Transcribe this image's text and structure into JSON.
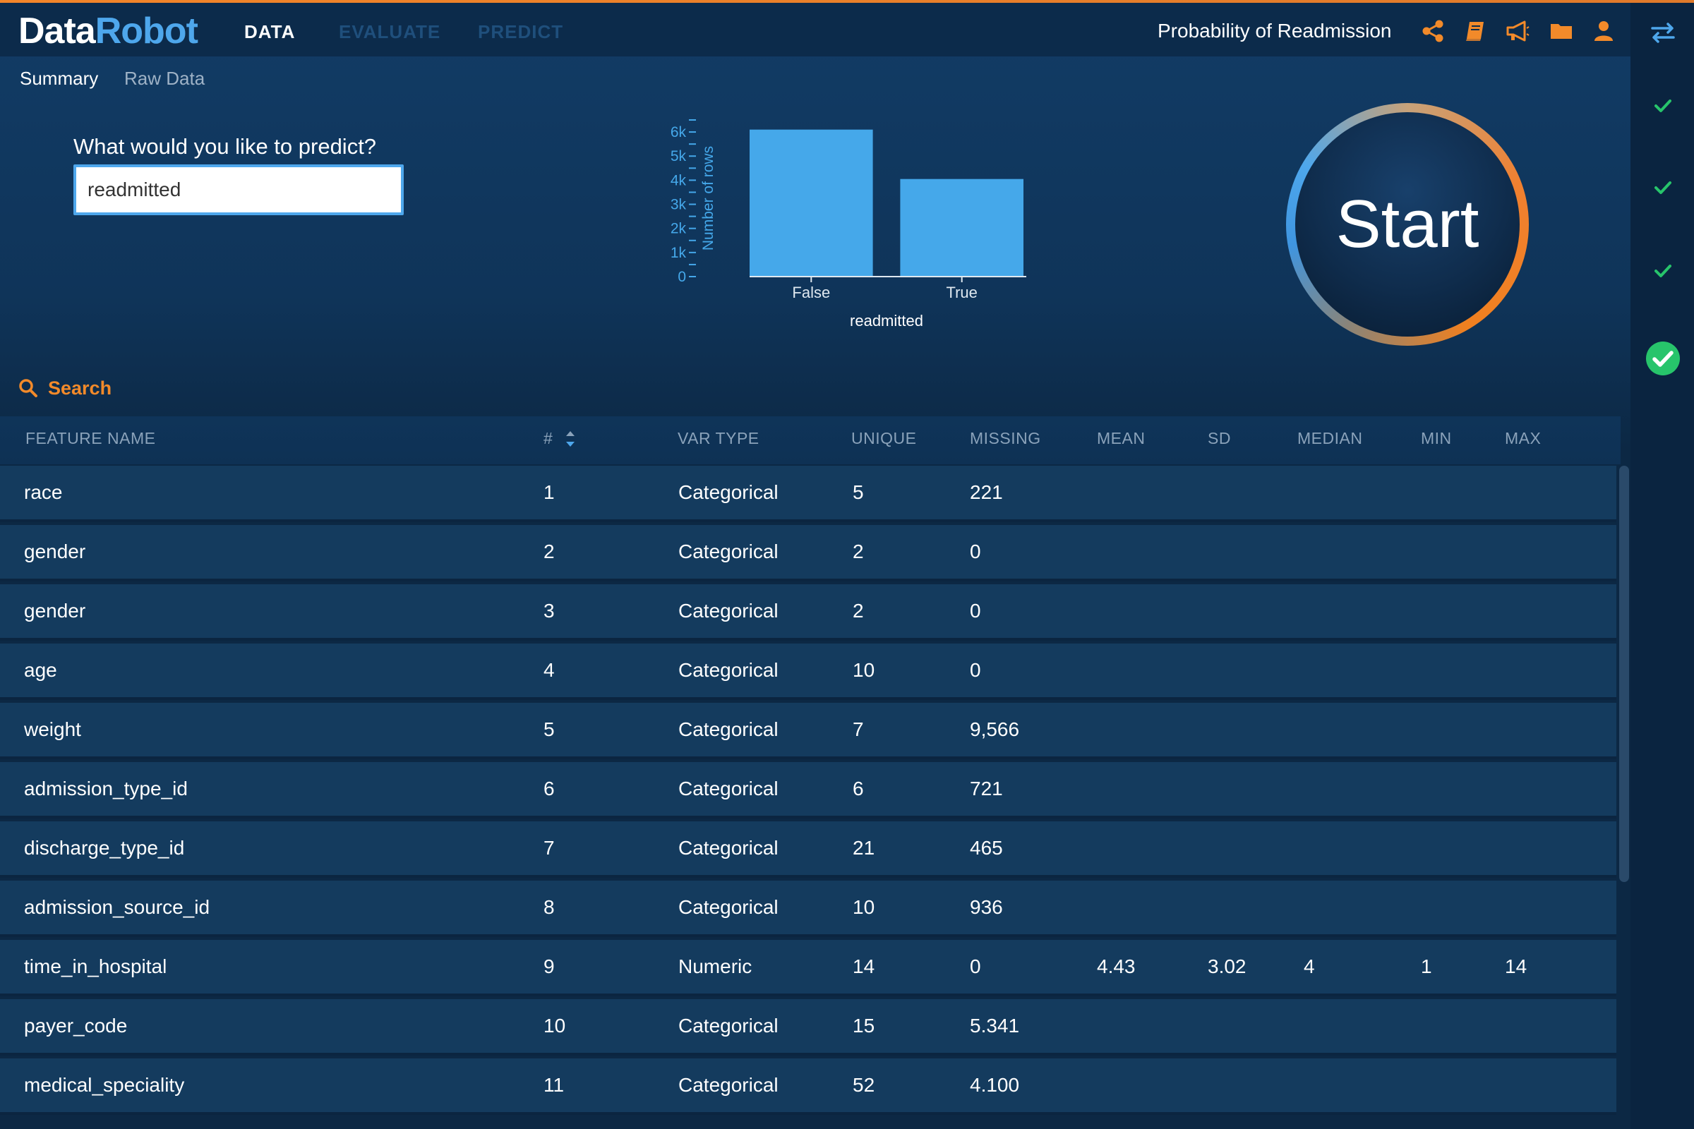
{
  "header": {
    "logo_part1": "Data",
    "logo_part2": "Robot",
    "nav": {
      "data": "DATA",
      "evaluate": "EVALUATE",
      "predict": "PREDICT"
    },
    "project_title": "Probability of Readmission",
    "icons": [
      "share-icon",
      "book-icon",
      "megaphone-icon",
      "folder-icon",
      "user-icon"
    ]
  },
  "rail": {
    "icons": [
      "swap-arrows-icon",
      "check-icon",
      "check-icon",
      "check-icon",
      "check-circle-icon"
    ]
  },
  "subtabs": {
    "summary": "Summary",
    "raw": "Raw Data"
  },
  "predict": {
    "label": "What would you like to predict?",
    "value": "readmitted"
  },
  "start_button": {
    "label": "Start"
  },
  "search": {
    "label": "Search"
  },
  "table": {
    "headers": {
      "feature_name": "FEATURE NAME",
      "index": "#",
      "var_type": "VAR TYPE",
      "unique": "UNIQUE",
      "missing": "MISSING",
      "mean": "MEAN",
      "sd": "SD",
      "median": "MEDIAN",
      "min": "MIN",
      "max": "MAX"
    },
    "rows": [
      {
        "name": " race",
        "idx": "1",
        "type": "Categorical",
        "unique": "5",
        "missing": "221",
        "mean": "",
        "sd": "",
        "median": "",
        "min": "",
        "max": ""
      },
      {
        "name": "gender",
        "idx": "2",
        "type": "Categorical",
        "unique": "2",
        "missing": "0",
        "mean": "",
        "sd": "",
        "median": "",
        "min": "",
        "max": ""
      },
      {
        "name": "gender",
        "idx": "3",
        "type": "Categorical",
        "unique": "2",
        "missing": "0",
        "mean": "",
        "sd": "",
        "median": "",
        "min": "",
        "max": ""
      },
      {
        "name": "age",
        "idx": "4",
        "type": "Categorical",
        "unique": "10",
        "missing": "0",
        "mean": "",
        "sd": "",
        "median": "",
        "min": "",
        "max": ""
      },
      {
        "name": "weight",
        "idx": "5",
        "type": "Categorical",
        "unique": "7",
        "missing": "9,566",
        "mean": "",
        "sd": "",
        "median": "",
        "min": "",
        "max": ""
      },
      {
        "name": "admission_type_id",
        "idx": "6",
        "type": "Categorical",
        "unique": "6",
        "missing": "721",
        "mean": "",
        "sd": "",
        "median": "",
        "min": "",
        "max": ""
      },
      {
        "name": "discharge_type_id",
        "idx": "7",
        "type": "Categorical",
        "unique": "21",
        "missing": "465",
        "mean": "",
        "sd": "",
        "median": "",
        "min": "",
        "max": ""
      },
      {
        "name": "admission_source_id",
        "idx": "8",
        "type": "Categorical",
        "unique": "10",
        "missing": "936",
        "mean": "",
        "sd": "",
        "median": "",
        "min": "",
        "max": ""
      },
      {
        "name": "time_in_hospital",
        "idx": "9",
        "type": "Numeric",
        "unique": "14",
        "missing": "0",
        "mean": "4.43",
        "sd": "3.02",
        "median": "4",
        "min": "1",
        "max": "14"
      },
      {
        "name": "payer_code",
        "idx": "10",
        "type": "Categorical",
        "unique": "15",
        "missing": "5.341",
        "mean": "",
        "sd": "",
        "median": "",
        "min": "",
        "max": ""
      },
      {
        "name": "medical_speciality",
        "idx": "11",
        "type": "Categorical",
        "unique": "52",
        "missing": "4.100",
        "mean": "",
        "sd": "",
        "median": "",
        "min": "",
        "max": ""
      }
    ]
  },
  "colors": {
    "accent_orange": "#f28a2a",
    "accent_blue": "#4ea7ec",
    "success_green": "#27c46b"
  },
  "chart_data": {
    "type": "bar",
    "categories": [
      "False",
      "True"
    ],
    "values": [
      6100,
      4050
    ],
    "xlabel": "readmitted",
    "ylabel": "Number of rows",
    "ylim": [
      0,
      6500
    ],
    "yticks": [
      0,
      1000,
      2000,
      3000,
      4000,
      5000,
      6000
    ],
    "ytick_labels": [
      "0",
      "1k",
      "2k",
      "3k",
      "4k",
      "5k",
      "6k"
    ],
    "bar_color": "#45a8ea"
  }
}
